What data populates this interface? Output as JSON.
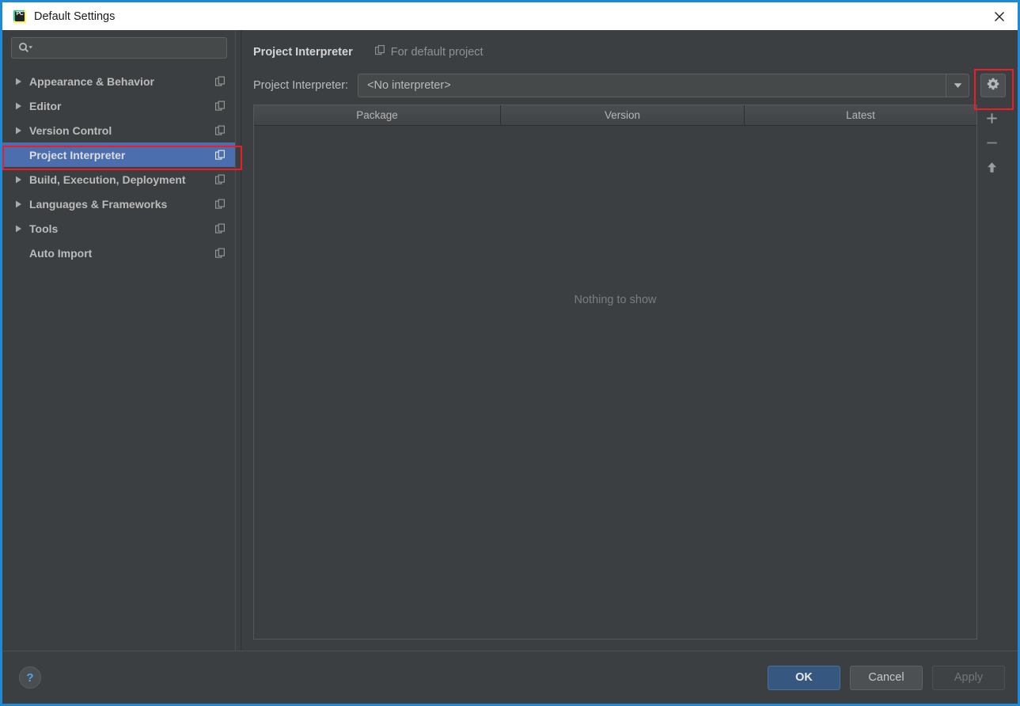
{
  "window": {
    "title": "Default Settings",
    "app_icon": "pycharm-icon",
    "icon_text": "PC",
    "close_icon": "close-icon",
    "border_color": "#1e8ad6"
  },
  "sidebar": {
    "search": {
      "value": "",
      "placeholder": "",
      "icon": "search-icon",
      "dropdown_icon": "chevron-down-icon"
    },
    "items": [
      {
        "label": "Appearance & Behavior",
        "expandable": true,
        "selected": false,
        "copy_icon": "copy-icon"
      },
      {
        "label": "Editor",
        "expandable": true,
        "selected": false,
        "copy_icon": "copy-icon"
      },
      {
        "label": "Version Control",
        "expandable": true,
        "selected": false,
        "copy_icon": "copy-icon"
      },
      {
        "label": "Project Interpreter",
        "expandable": false,
        "selected": true,
        "copy_icon": "copy-icon"
      },
      {
        "label": "Build, Execution, Deployment",
        "expandable": true,
        "selected": false,
        "copy_icon": "copy-icon"
      },
      {
        "label": "Languages & Frameworks",
        "expandable": true,
        "selected": false,
        "copy_icon": "copy-icon"
      },
      {
        "label": "Tools",
        "expandable": true,
        "selected": false,
        "copy_icon": "copy-icon"
      },
      {
        "label": "Auto Import",
        "expandable": false,
        "selected": false,
        "copy_icon": "copy-icon"
      }
    ],
    "selection_color": "#4b6eaf"
  },
  "main": {
    "header": {
      "title": "Project Interpreter",
      "scope_label": "For default project",
      "scope_icon": "copy-icon"
    },
    "interpreter": {
      "label": "Project Interpreter:",
      "value": "<No interpreter>",
      "dropdown_icon": "triangle-down-icon",
      "gear_icon": "gear-icon"
    },
    "packages_table": {
      "columns": [
        "Package",
        "Version",
        "Latest"
      ],
      "rows": [],
      "empty_message": "Nothing to show"
    },
    "table_toolbar": [
      {
        "name": "add-package-button",
        "icon": "plus-icon"
      },
      {
        "name": "remove-package-button",
        "icon": "minus-icon"
      },
      {
        "name": "upgrade-package-button",
        "icon": "arrow-up-icon"
      }
    ]
  },
  "footer": {
    "help_icon": "question-mark-icon",
    "help_label": "?",
    "ok_label": "OK",
    "cancel_label": "Cancel",
    "apply_label": "Apply",
    "apply_disabled": true,
    "primary_color": "#365880"
  },
  "annotations": {
    "color": "#ee1c24",
    "boxes": [
      "sidebar-project-interpreter",
      "gear-button"
    ]
  }
}
